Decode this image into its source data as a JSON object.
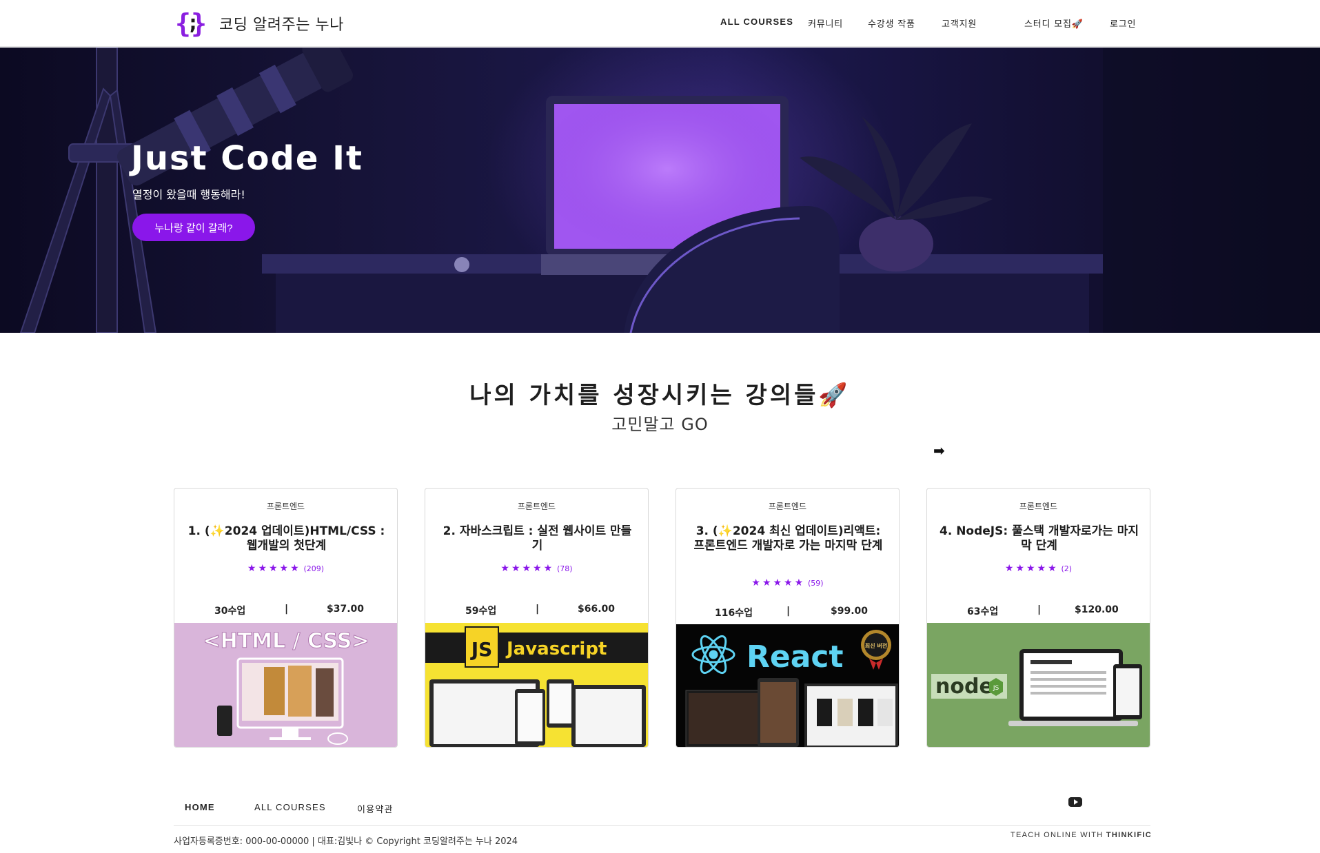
{
  "header": {
    "logo": {
      "left": "{",
      "semi": ";",
      "right": "}"
    },
    "brand_name": "코딩 알려주는 누나",
    "nav": [
      "ALL COURSES",
      "커뮤니티",
      "수강생 작품",
      "고객지원",
      "스터디 모집🚀",
      "로그인"
    ]
  },
  "hero": {
    "title": "Just Code It",
    "subtitle": "열정이 왔을때 행동해라!",
    "button": "누나랑 같이 갈래?"
  },
  "section": {
    "title": "나의 가치를 성장시키는 강의들🚀",
    "subtitle": "고민말고 GO",
    "arrow": "➡"
  },
  "courses": [
    {
      "category": "프론트엔드",
      "title": "1. (✨2024 업데이트)HTML/CSS : 웹개발의 첫단계",
      "stars": "★★★★★",
      "reviews": "(209)",
      "lessons": "30수업",
      "price": "$37.00",
      "thumb_text": "<HTML / CSS>"
    },
    {
      "category": "프론트엔드",
      "title": "2. 자바스크립트 : 실전 웹사이트 만들기",
      "stars": "★★★★★",
      "reviews": "(78)",
      "lessons": "59수업",
      "price": "$66.00",
      "thumb_text": "Javascript",
      "thumb_badge": "JS"
    },
    {
      "category": "프론트엔드",
      "title": "3. (✨2024 최신 업데이트)리액트: 프론트엔드 개발자로 가는 마지막 단계",
      "stars": "★★★★★",
      "reviews": "(59)",
      "lessons": "116수업",
      "price": "$99.00",
      "thumb_text": "React",
      "thumb_badge": "최신 버전"
    },
    {
      "category": "프론트엔드",
      "title": "4. NodeJS: 풀스택 개발자로가는 마지막 단계",
      "stars": "★★★★★",
      "reviews": "(2)",
      "lessons": "63수업",
      "price": "$120.00",
      "thumb_text": "node",
      "thumb_badge": "JS"
    }
  ],
  "separator": "|",
  "footer": {
    "links": [
      "HOME",
      "ALL COURSES",
      "이용약관"
    ],
    "copyright": "사업자등록증번호: 000-00-00000 | 대표:김빛나 © Copyright 코딩알려주는 누나 2024",
    "teach_prefix": "TEACH ONLINE WITH ",
    "teach_brand": "THINKIFIC",
    "social_icon": "youtube-icon"
  },
  "colors": {
    "accent": "#8a17ea",
    "hero_bg": "#17143a"
  }
}
